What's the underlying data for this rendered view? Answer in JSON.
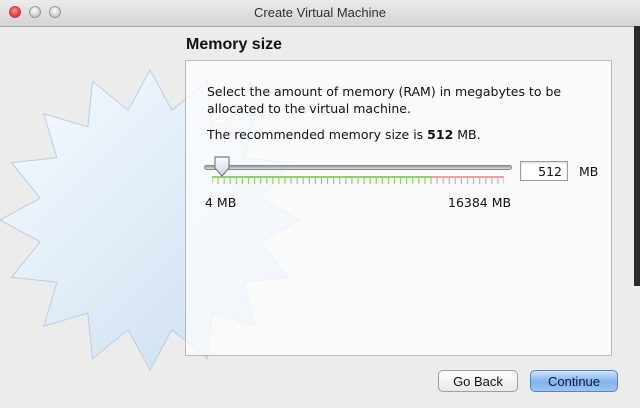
{
  "window": {
    "title": "Create Virtual Machine"
  },
  "page": {
    "heading": "Memory size",
    "description": "Select the amount of memory (RAM) in megabytes to be allocated to the virtual machine.",
    "recommendation_prefix": "The recommended memory size is ",
    "recommendation_value": "512",
    "recommendation_suffix": " MB."
  },
  "memory": {
    "value": "512",
    "unit": "MB",
    "min_label": "4 MB",
    "max_label": "16384 MB",
    "slider_fraction": 0.03,
    "safe_range_end_fraction": 0.75
  },
  "buttons": {
    "back": "Go Back",
    "continue": "Continue"
  },
  "colors": {
    "safe_zone": "#8fd06a",
    "danger_zone": "#f0a0a0",
    "primary_button": "#7fb2ef"
  }
}
